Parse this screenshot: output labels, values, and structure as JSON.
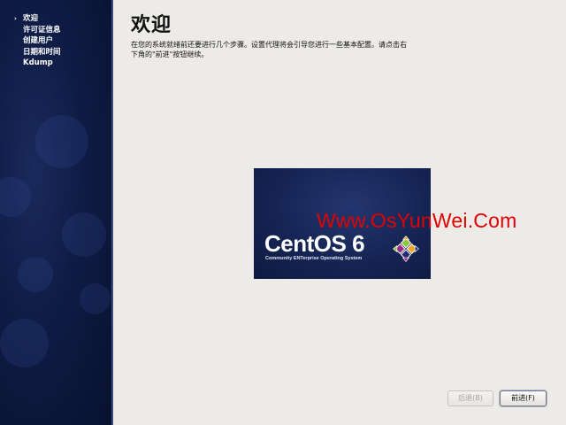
{
  "sidebar": {
    "current_marker": "›",
    "steps": [
      {
        "label": "欢迎"
      },
      {
        "label": "许可证信息"
      },
      {
        "label": "创建用户"
      },
      {
        "label": "日期和时间"
      },
      {
        "label": "Kdump"
      }
    ]
  },
  "main": {
    "title": "欢迎",
    "intro": "在您的系统就绪前还要进行几个步骤。设置代理将会引导您进行一些基本配置。请点击右下角的\"前进\"按钮继续。"
  },
  "logo": {
    "wordmark": "CentOS 6",
    "tagline": "Community ENTerprise Operating System",
    "mark_icon": "centos-pinwheel-icon",
    "colors": {
      "green": "#8cc63f",
      "orange": "#efa724",
      "blue": "#262577",
      "purple": "#9c2983"
    }
  },
  "watermark": {
    "text": "Www.OsYunWei.Com",
    "color": "#e10000"
  },
  "buttons": {
    "back_label": "后退(B)",
    "next_label": "前进(F)"
  }
}
